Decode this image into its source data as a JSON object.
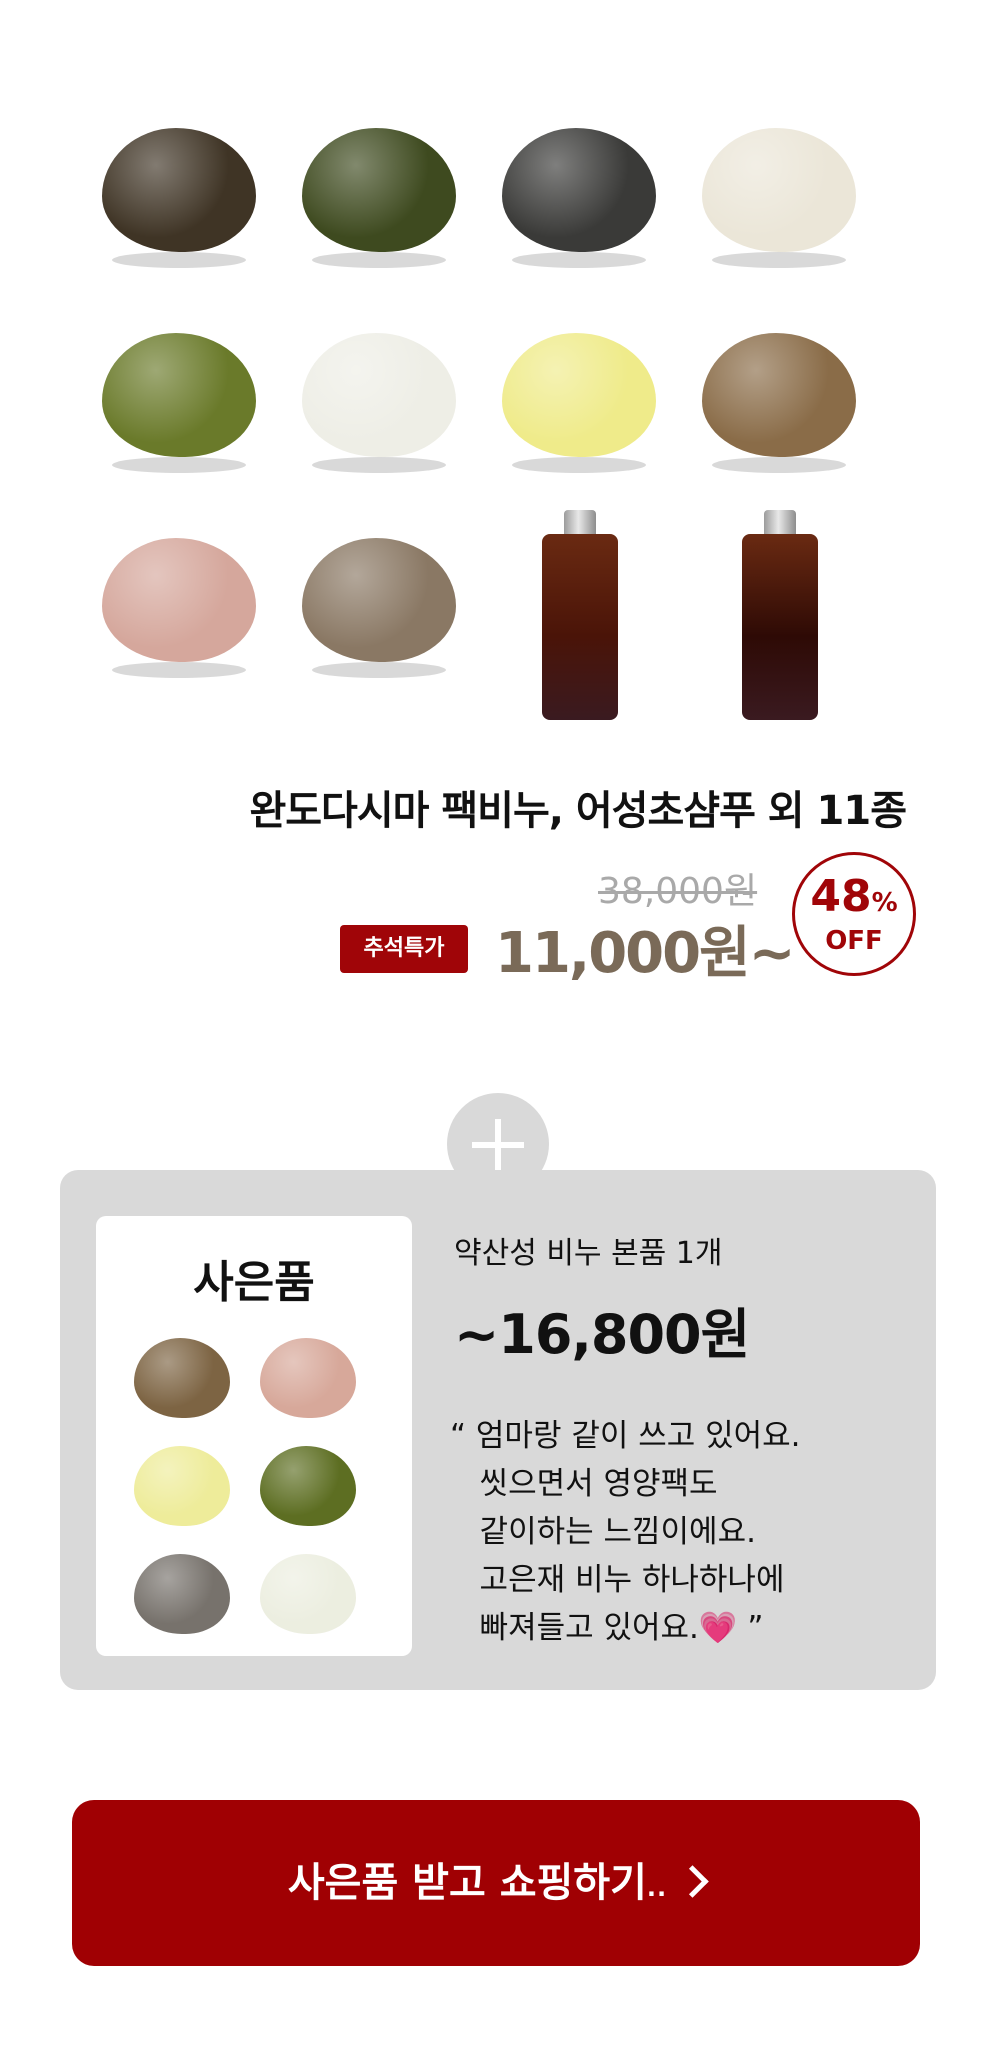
{
  "product": {
    "title": "완도다시마 팩비누, 어성초샴푸 외 11종",
    "original_price": "38,000원",
    "event_badge": "추석특가",
    "price": "11,000원~",
    "discount_percent": "48",
    "discount_symbol": "%",
    "discount_label": "OFF",
    "items": [
      {
        "type": "soap",
        "color": "#3f3425"
      },
      {
        "type": "soap",
        "color": "#3e4a1f"
      },
      {
        "type": "soap",
        "color": "#3a3a38"
      },
      {
        "type": "soap",
        "color": "#ebe6d8"
      },
      {
        "type": "soap",
        "color": "#6a7a2a"
      },
      {
        "type": "soap",
        "color": "#eeeee6"
      },
      {
        "type": "soap",
        "color": "#efeb8a"
      },
      {
        "type": "soap",
        "color": "#8a6c48"
      },
      {
        "type": "soap",
        "color": "#d5a79c"
      },
      {
        "type": "soap",
        "color": "#8a7864"
      },
      {
        "type": "bottle",
        "color": "#4a1408"
      },
      {
        "type": "bottle",
        "color": "#2e0a05"
      }
    ]
  },
  "gift": {
    "card_title": "사은품",
    "subtitle": "약산성 비누 본품 1개",
    "price": "~16,800원",
    "review_lines": [
      "“ 엄마랑 같이 쓰고 있어요.",
      "   씻으면서 영양팩도",
      "   같이하는 느낌이에요.",
      "   고은재 비누 하나하나에",
      "   빠져들고 있어요."
    ],
    "review_heart": "💗",
    "review_close": " ”",
    "soaps": [
      "#7d6443",
      "#d7a89a",
      "#eeec9a",
      "#5d6e22",
      "#77726c",
      "#eceee0"
    ]
  },
  "cta": {
    "label": "사은품 받고 쇼핑하기",
    "dots": ".."
  }
}
